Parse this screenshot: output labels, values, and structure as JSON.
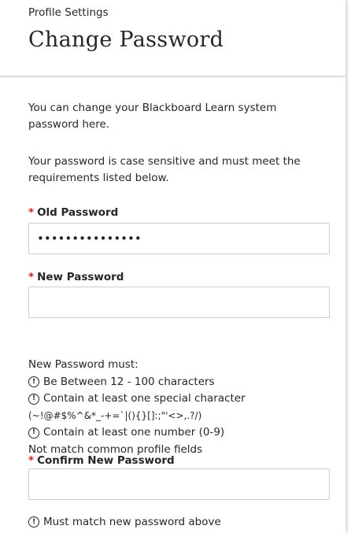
{
  "header": {
    "breadcrumb": "Profile Settings",
    "title": "Change Password"
  },
  "intro": {
    "line1": "You can change your Blackboard Learn system password here.",
    "line2": "Your password is case sensitive and must meet the requirements listed below."
  },
  "form": {
    "required_marker": "*",
    "old_password": {
      "label": "Old Password",
      "value": "•••••••••••••••",
      "placeholder": ""
    },
    "new_password": {
      "label": "New Password",
      "value": "",
      "placeholder": ""
    },
    "confirm_password": {
      "label": "Confirm New Password",
      "value": "",
      "placeholder": ""
    }
  },
  "rules": {
    "heading": "New Password must:",
    "icon": "info-circle-icon",
    "items": [
      "Be Between 12 - 100 characters",
      "Contain at least one special character",
      "(~!@#$%^&*_-+=`|(){}[]:;\"'<>,.?/)",
      "Contain at least one number (0-9)",
      "Not match common profile fields"
    ]
  },
  "confirm_note": "Must match new password above",
  "colors": {
    "required": "#c51f1f",
    "text": "#262626",
    "border": "#cdcdcd"
  }
}
